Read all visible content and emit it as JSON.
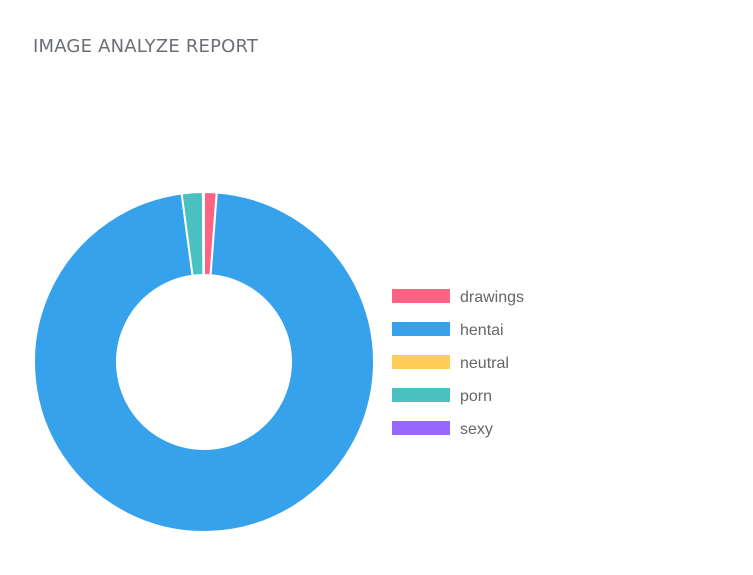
{
  "page": {
    "title": "IMAGE ANALYZE REPORT"
  },
  "chart_data": {
    "type": "doughnut",
    "title": "",
    "categories": [
      "drawings",
      "hentai",
      "neutral",
      "porn",
      "sexy"
    ],
    "values": [
      1.2,
      96.7,
      0.0,
      2.0,
      0.1
    ],
    "colors": [
      "#ff6384",
      "#36a2eb",
      "#ffcd56",
      "#4bc0c0",
      "#9966ff"
    ],
    "legend_position": "right",
    "series": [
      {
        "name": "",
        "values": [
          1.2,
          96.7,
          0.0,
          2.0,
          0.1
        ]
      }
    ]
  }
}
